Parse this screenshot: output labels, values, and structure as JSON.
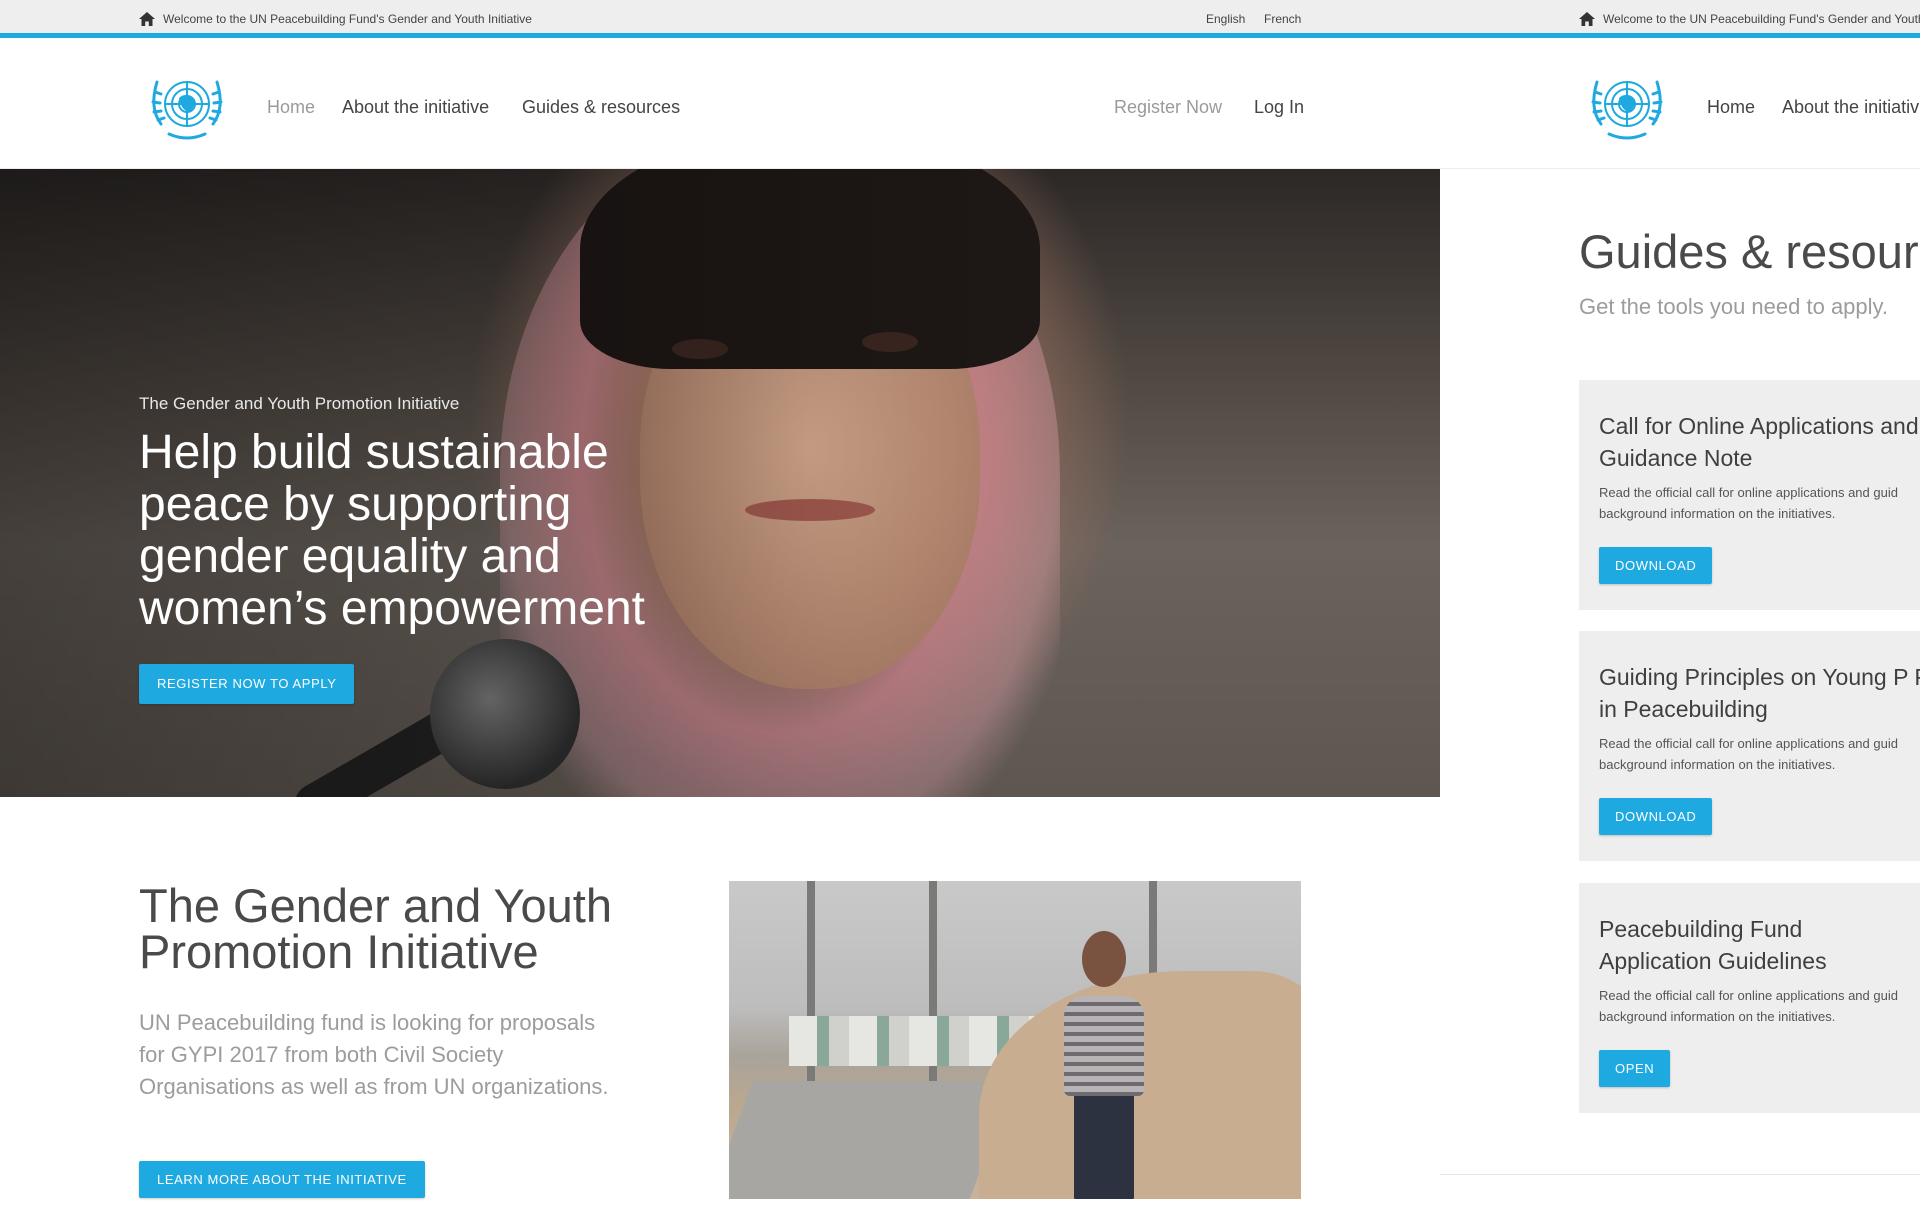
{
  "brand": {
    "accent_color": "#1fa9e1",
    "logo_icon": "un-emblem-icon"
  },
  "topbar": {
    "welcome": "Welcome to the UN Peacebuilding Fund's Gender and Youth Initiative",
    "welcome_cut": "Welcome to the UN Peacebuilding Fund's Gender and Youth",
    "home_icon": "home-icon",
    "languages": [
      "English",
      "French"
    ]
  },
  "nav": {
    "left": [
      "Home",
      "About the initiative",
      "Guides & resources"
    ],
    "right": [
      "Register Now",
      "Log In"
    ],
    "right_pane": [
      "Home",
      "About the initiativ"
    ]
  },
  "hero": {
    "eyebrow": "The Gender and Youth Promotion Initiative",
    "title": "Help build sustainable peace by supporting gender equality and women’s empowerment",
    "cta": "REGISTER NOW TO APPLY"
  },
  "intro": {
    "title": "The Gender and Youth Promotion Initiative",
    "text": "UN Peacebuilding fund is looking for proposals for GYPI 2017 from both Civil Society Organisations as well as from UN organizations.",
    "cta": "LEARN MORE ABOUT THE INITIATIVE"
  },
  "guides": {
    "title": "Guides & resourc",
    "subtitle": "Get the tools you need to apply.",
    "cards": [
      {
        "title": "Call for Online Applications and Guidance Note",
        "line1": "Read the official call for online applications and guid",
        "line2": "background information on the initiatives.",
        "button": "DOWNLOAD"
      },
      {
        "title": "Guiding Principles on Young P Participation in Peacebuilding",
        "line1": "Read the official call for online applications and guid",
        "line2": "background information on the initiatives.",
        "button": "DOWNLOAD"
      },
      {
        "title": "Peacebuilding Fund Application Guidelines",
        "line1": "Read the official call for online applications and guid",
        "line2": "background information on the initiatives.",
        "button": "OPEN"
      }
    ]
  }
}
